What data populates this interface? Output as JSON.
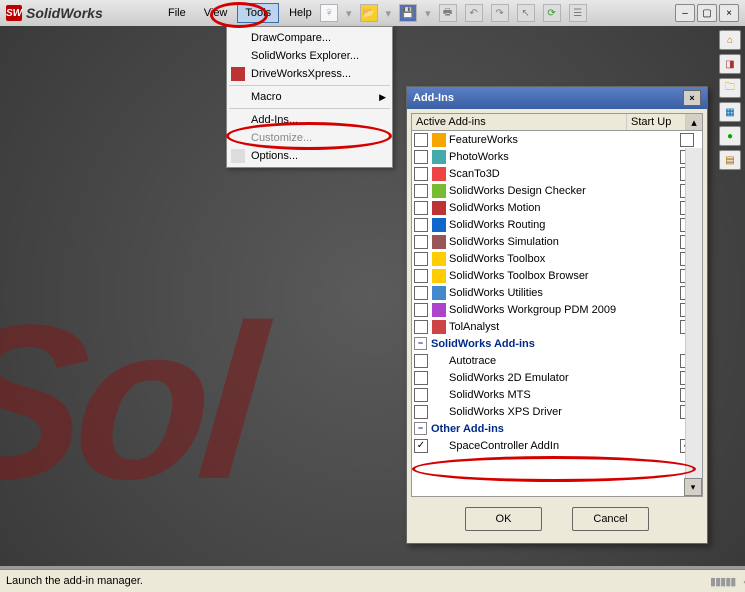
{
  "title": "SolidWorks",
  "menus": {
    "file": "File",
    "view": "View",
    "tools": "Tools",
    "help": "Help"
  },
  "win_controls": {
    "min": "–",
    "max": "▢",
    "close": "×"
  },
  "tools_menu": {
    "draw_compare": "DrawCompare...",
    "sw_explorer": "SolidWorks Explorer...",
    "drive_works": "DriveWorksXpress...",
    "macro": "Macro",
    "addins": "Add-Ins...",
    "customize": "Customize...",
    "options": "Options..."
  },
  "dialog": {
    "title": "Add-Ins",
    "col_active": "Active Add-ins",
    "col_start": "Start Up",
    "sections": {
      "sw": "SolidWorks Add-ins",
      "other": "Other Add-ins"
    },
    "items1": [
      "FeatureWorks",
      "PhotoWorks",
      "ScanTo3D",
      "SolidWorks Design Checker",
      "SolidWorks Motion",
      "SolidWorks Routing",
      "SolidWorks Simulation",
      "SolidWorks Toolbox",
      "SolidWorks Toolbox Browser",
      "SolidWorks Utilities",
      "SolidWorks Workgroup PDM 2009",
      "TolAnalyst"
    ],
    "items2": [
      "Autotrace",
      "SolidWorks 2D Emulator",
      "SolidWorks MTS",
      "SolidWorks XPS Driver"
    ],
    "item_other": "SpaceController AddIn",
    "ok": "OK",
    "cancel": "Cancel"
  },
  "status": "Launch the add-in manager.",
  "icon_colors": [
    "#f7a500",
    "#4aa",
    "#e44",
    "#7b3",
    "#b33",
    "#16c",
    "#955",
    "#fc0",
    "#fc0",
    "#48c",
    "#a4c",
    "#c44"
  ]
}
